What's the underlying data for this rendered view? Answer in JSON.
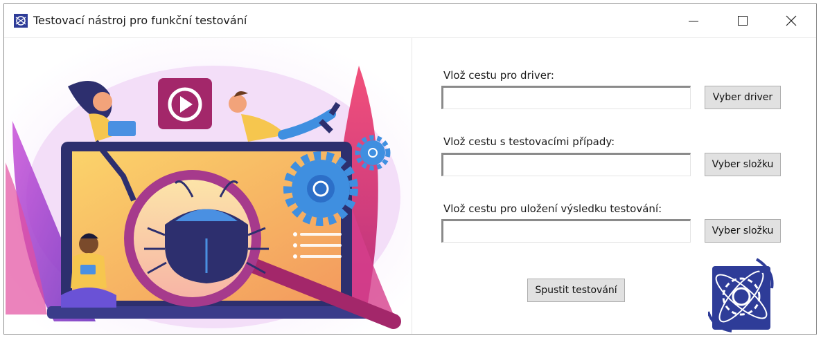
{
  "window": {
    "title": "Testovací nástroj pro funkční testování",
    "controls": [
      "minimize",
      "maximize",
      "close"
    ]
  },
  "form": {
    "driver": {
      "label": "Vlož cestu pro driver:",
      "value": "",
      "button_label": "Vyber driver"
    },
    "testcases": {
      "label": "Vlož cestu s testovacími případy:",
      "value": "",
      "button_label": "Vyber složku"
    },
    "results": {
      "label": "Vlož cestu pro uložení výsledku testování:",
      "value": "",
      "button_label": "Vyber složku"
    },
    "run_button_label": "Spustit testování"
  },
  "icons": {
    "app": "app-logo-icon",
    "minimize": "minimize-icon",
    "maximize": "maximize-icon",
    "close": "close-icon",
    "logo": "university-gear-atom-logo"
  },
  "colors": {
    "illustration_purple": "#9b3fd0",
    "illustration_pink": "#e8417a",
    "illustration_yellow": "#f6c64e",
    "logo_blue": "#2e3c98"
  }
}
